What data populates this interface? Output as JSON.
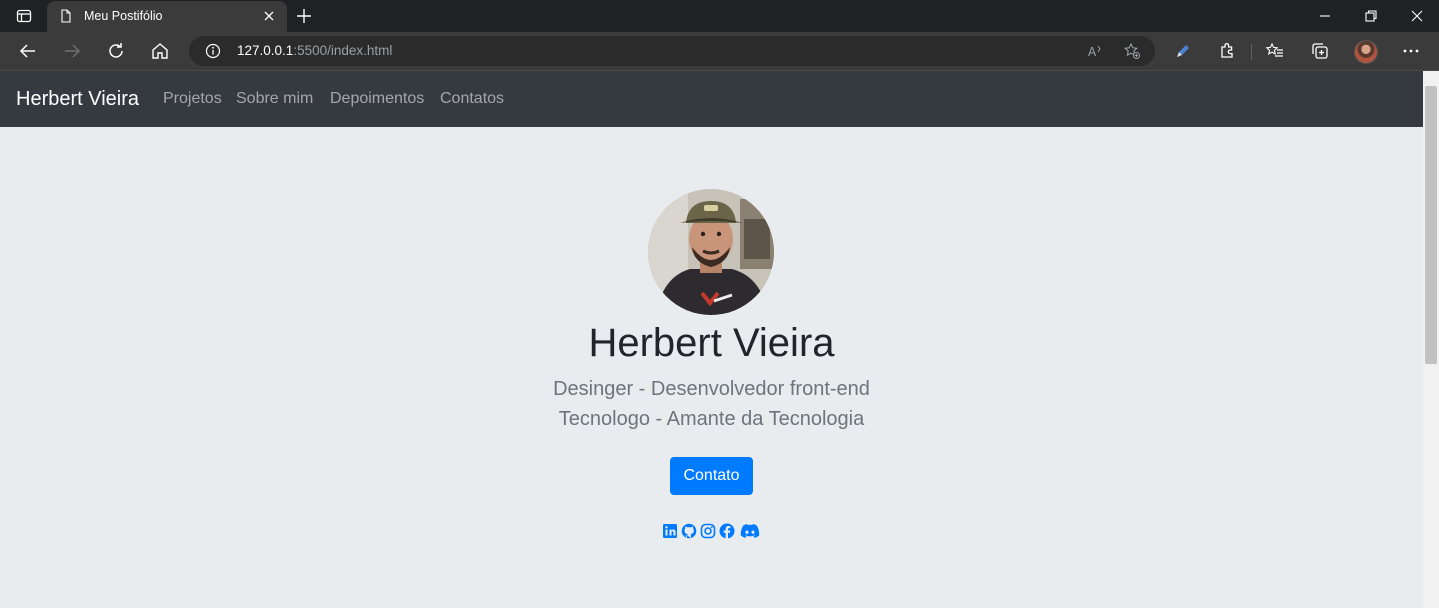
{
  "browser": {
    "tab_title": "Meu Postifólio",
    "url_host": "127.0.0.1",
    "url_rest": ":5500/index.html"
  },
  "site_nav": {
    "brand": "Herbert Vieira",
    "links": [
      "Projetos",
      "Sobre mim",
      "Depoimentos",
      "Contatos"
    ]
  },
  "hero": {
    "name": "Herbert Vieira",
    "subtitle_line1": "Desinger - Desenvolvedor front-end",
    "subtitle_line2": "Tecnologo - Amante da Tecnologia",
    "contact_button": "Contato",
    "social_icons": [
      "linkedin-icon",
      "github-icon",
      "instagram-icon",
      "facebook-icon",
      "discord-icon"
    ]
  },
  "colors": {
    "navbar": "#343a40",
    "hero_bg": "#e9ecef",
    "primary": "#007bff",
    "chrome": "#202124"
  }
}
